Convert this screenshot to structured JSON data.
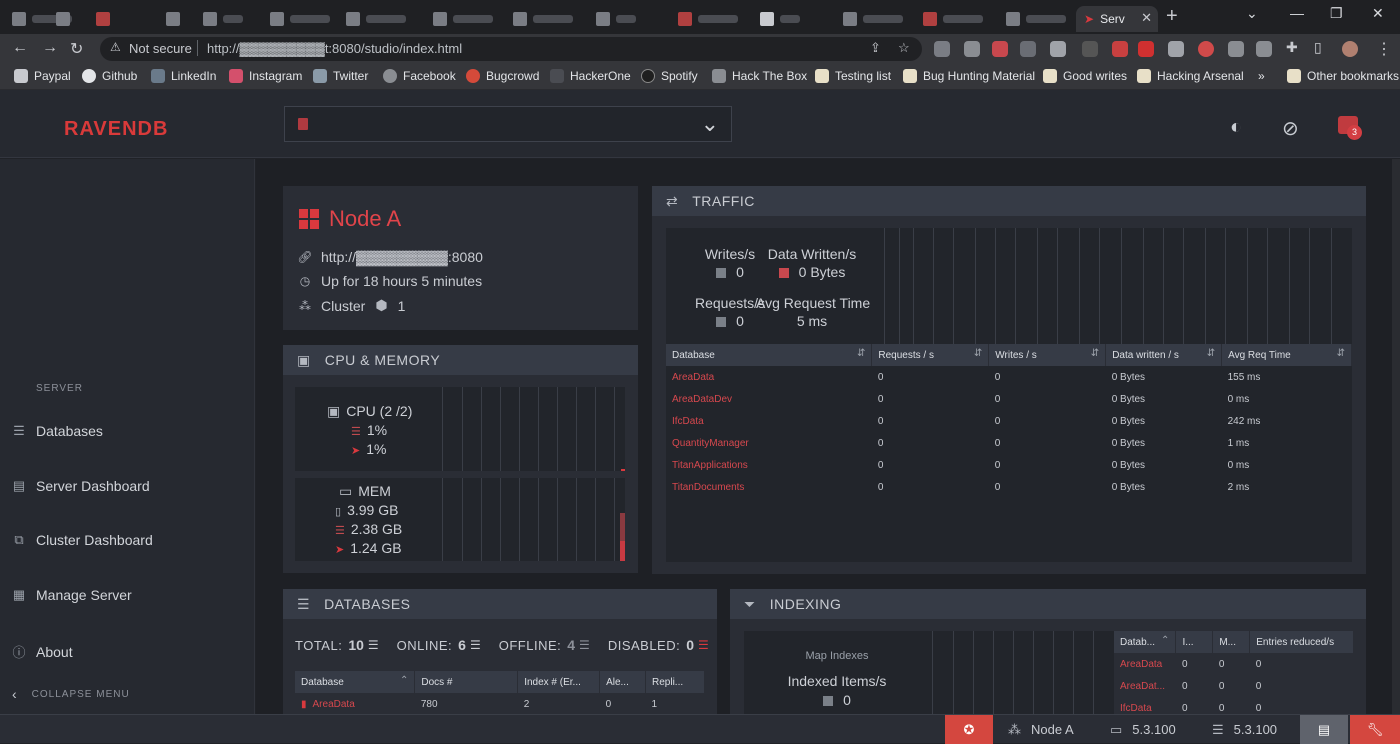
{
  "browser": {
    "active_tab_label": "Serv",
    "omnibox": {
      "security": "Not secure",
      "url": "http://▓▓▓▓▓▓▓▓▓t:8080/studio/index.html"
    },
    "bookmarks": [
      "Paypal",
      "Github",
      "LinkedIn",
      "Instagram",
      "Twitter",
      "Facebook",
      "Bugcrowd",
      "HackerOne",
      "Spotify",
      "Hack The Box",
      "Testing list",
      "Bug Hunting Material",
      "Good writes",
      "Hacking Arsenal"
    ],
    "bookmark_overflow": "»",
    "other_bookmarks": "Other bookmarks"
  },
  "studio": {
    "logo": "RAVENDB",
    "notifications_count": "3"
  },
  "sidebar": {
    "section_title": "SERVER",
    "items": [
      {
        "label": "Databases",
        "icon": "databases-icon"
      },
      {
        "label": "Server Dashboard",
        "icon": "dashboard-icon"
      },
      {
        "label": "Cluster Dashboard",
        "icon": "cluster-dashboard-icon"
      },
      {
        "label": "Manage Server",
        "icon": "manage-server-icon"
      },
      {
        "label": "About",
        "icon": "info-icon"
      }
    ],
    "collapse_label": "COLLAPSE MENU"
  },
  "node": {
    "title": "Node A",
    "url": "http://▓▓▓▓▓▓▓▓▓:8080",
    "uptime": "Up for 18 hours 5 minutes",
    "cluster_label": "Cluster",
    "cluster_value": "1"
  },
  "cpu_memory": {
    "title": "CPU & MEMORY",
    "cpu_label": "CPU (2 /2)",
    "cpu_machine": "1%",
    "cpu_ravendb": "1%",
    "mem_label": "MEM",
    "mem_total": "3.99 GB",
    "mem_machine": "2.38 GB",
    "mem_ravendb": "1.24 GB"
  },
  "traffic": {
    "title": "TRAFFIC",
    "writes_label": "Writes/s",
    "writes_value": "0",
    "data_written_label": "Data Written/s",
    "data_written_value": "0 Bytes",
    "requests_label": "Requests/s",
    "requests_value": "0",
    "avg_req_label": "Avg Request Time",
    "avg_req_value": "5 ms",
    "columns": [
      "Database",
      "Requests / s",
      "Writes / s",
      "Data written / s",
      "Avg Req Time"
    ],
    "rows": [
      [
        "AreaData",
        "0",
        "0",
        "0 Bytes",
        "155 ms"
      ],
      [
        "AreaDataDev",
        "0",
        "0",
        "0 Bytes",
        "0 ms"
      ],
      [
        "IfcData",
        "0",
        "0",
        "0 Bytes",
        "242 ms"
      ],
      [
        "QuantityManager",
        "0",
        "0",
        "0 Bytes",
        "1 ms"
      ],
      [
        "TitanApplications",
        "0",
        "0",
        "0 Bytes",
        "0 ms"
      ],
      [
        "TitanDocuments",
        "0",
        "0",
        "0 Bytes",
        "2 ms"
      ]
    ]
  },
  "databases": {
    "title": "DATABASES",
    "total_label": "TOTAL:",
    "total_value": "10",
    "online_label": "ONLINE:",
    "online_value": "6",
    "offline_label": "OFFLINE:",
    "offline_value": "4",
    "disabled_label": "DISABLED:",
    "disabled_value": "0",
    "columns": [
      "Database",
      "Docs #",
      "Index # (Er...",
      "Ale...",
      "Repli..."
    ],
    "rows": [
      [
        "AreaData",
        "780",
        "2",
        "0",
        "1"
      ]
    ]
  },
  "indexing": {
    "title": "INDEXING",
    "map_label": "Map Indexes",
    "items_label": "Indexed Items/s",
    "items_value": "0",
    "columns": [
      "Datab...",
      "I...",
      "M...",
      "Entries reduced/s"
    ],
    "rows": [
      [
        "AreaData",
        "0",
        "0",
        "0"
      ],
      [
        "AreaDat...",
        "0",
        "0",
        "0"
      ],
      [
        "IfcData",
        "0",
        "0",
        "0"
      ]
    ]
  },
  "statusbar": {
    "node_label": "Node A",
    "client_version": "5.3.100",
    "server_version": "5.3.100"
  },
  "colors": {
    "accent": "#d9393e",
    "panel": "#2a2d35",
    "header": "#363b46"
  }
}
